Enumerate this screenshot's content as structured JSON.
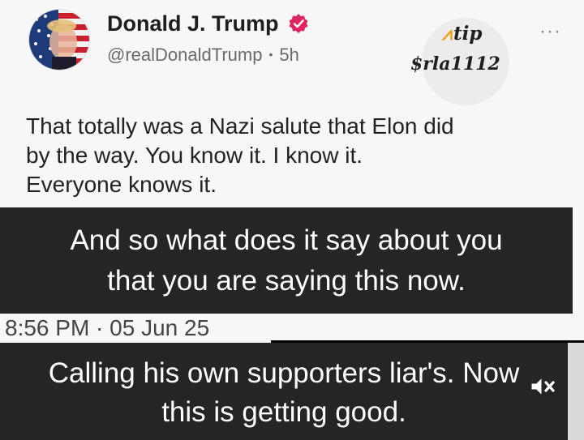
{
  "post": {
    "author_name": "Donald J. Trump",
    "handle": "@realDonaldTrump",
    "separator": "•",
    "time_ago": "5h",
    "text_lines": [
      "That totally was a Nazi salute that Elon did",
      "by the way. You know it. I know it.",
      "Everyone knows it."
    ],
    "timestamp": "8:56 PM · 05 Jun 25",
    "more_icon": "more-horizontal-icon",
    "verified_icon": "verified-badge-icon"
  },
  "tip": {
    "label": "tip",
    "handle": "$rla1112",
    "icon": "tip-logo-icon"
  },
  "captions": {
    "first_lines": [
      "And so what does it say about you",
      "that you are saying this now."
    ],
    "second_lines": [
      "Calling his own supporters liar's. Now",
      "this is getting good."
    ]
  },
  "controls": {
    "mute_icon": "speaker-muted-icon"
  },
  "colors": {
    "verified": "#e0245e",
    "caption_bg": "#252525",
    "card_bg": "#f7f7f7"
  }
}
